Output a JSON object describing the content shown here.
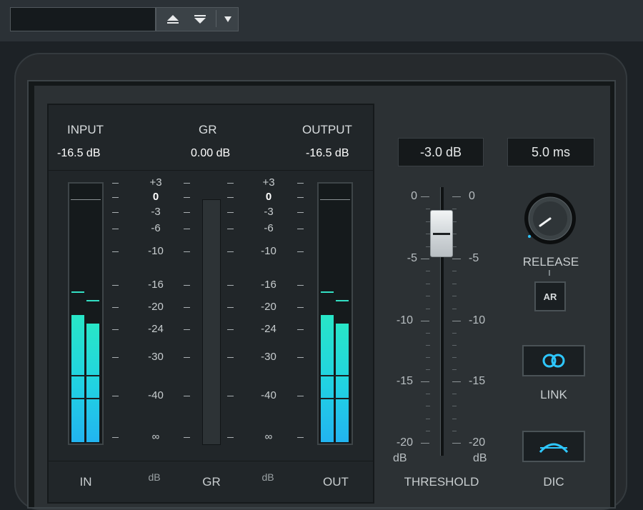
{
  "toolbar": {
    "preset_value": "",
    "prev_icon": "arrow-up-icon",
    "next_icon": "arrow-down-icon",
    "menu_icon": "dropdown-triangle-icon"
  },
  "meters": {
    "input_label": "INPUT",
    "gr_label": "GR",
    "output_label": "OUTPUT",
    "input_value": "-16.5 dB",
    "gr_value": "0.00 dB",
    "output_value": "-16.5 dB",
    "input_level_fraction": 0.49,
    "output_level_fraction": 0.49,
    "scale": [
      "+3",
      "0",
      "-3",
      "-6",
      "-10",
      "-16",
      "-20",
      "-24",
      "-30",
      "-40",
      "∞"
    ],
    "bottom": {
      "in": "IN",
      "db_left": "dB",
      "gr": "GR",
      "db_right": "dB",
      "out": "OUT"
    }
  },
  "threshold": {
    "readout": "-3.0 dB",
    "scale_left": [
      "0",
      "-5",
      "-10",
      "-15",
      "-20"
    ],
    "scale_right": [
      "0",
      "-5",
      "-10",
      "-15",
      "-20"
    ],
    "unit_left": "dB",
    "unit_right": "dB",
    "label": "THRESHOLD",
    "value_db": -3.0
  },
  "release": {
    "readout": "5.0 ms",
    "label": "RELEASE",
    "ar_label": "AR",
    "knob_icon": "knob-icon"
  },
  "link": {
    "label": "LINK",
    "icon": "link-rings-icon"
  },
  "dic": {
    "label": "DIC",
    "icon": "arc-curve-icon"
  },
  "colors": {
    "meter_top": "#28e6c7",
    "meter_bottom": "#22b4f0",
    "accent": "#2ec7ff"
  }
}
